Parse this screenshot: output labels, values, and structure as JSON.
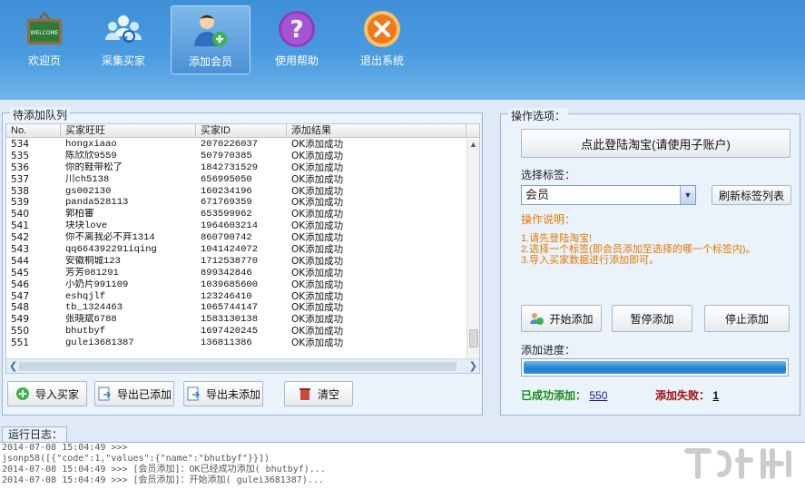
{
  "toolbar": {
    "items": [
      {
        "label": "欢迎页",
        "icon": "welcome-board-icon",
        "active": false
      },
      {
        "label": "采集买家",
        "icon": "collect-buyers-icon",
        "active": false
      },
      {
        "label": "添加会员",
        "icon": "add-member-icon",
        "active": true
      },
      {
        "label": "使用帮助",
        "icon": "help-icon",
        "active": false
      },
      {
        "label": "退出系统",
        "icon": "exit-icon",
        "active": false
      }
    ]
  },
  "queue": {
    "title": "待添加队列",
    "columns": [
      "No.",
      "买家旺旺",
      "买家ID",
      "添加结果"
    ],
    "rows": [
      [
        "534",
        "hongxiaao",
        "2070226037",
        "OK添加成功"
      ],
      [
        "535",
        "陈欣欣9559",
        "507970385",
        "OK添加成功"
      ],
      [
        "536",
        "你的鞋带松了",
        "1842731529",
        "OK添加成功"
      ],
      [
        "537",
        "川ch5138",
        "656995050",
        "OK添加成功"
      ],
      [
        "538",
        "gs002130",
        "160234196",
        "OK添加成功"
      ],
      [
        "539",
        "panda528113",
        "671769359",
        "OK添加成功"
      ],
      [
        "540",
        "郭柏審",
        "653599962",
        "OK添加成功"
      ],
      [
        "541",
        "块块love",
        "1964603214",
        "OK添加成功"
      ],
      [
        "542",
        "你不离我必不弃1314",
        "860790742",
        "OK添加成功"
      ],
      [
        "543",
        "qq664392291iqing",
        "1041424072",
        "OK添加成功"
      ],
      [
        "544",
        "安徽桐城123",
        "1712538770",
        "OK添加成功"
      ],
      [
        "545",
        "芳芳081291",
        "899342846",
        "OK添加成功"
      ],
      [
        "546",
        "小奶片991109",
        "1039685600",
        "OK添加成功"
      ],
      [
        "547",
        "eshqjlf",
        "123246410",
        "OK添加成功"
      ],
      [
        "548",
        "tb_1324463",
        "1065744147",
        "OK添加成功"
      ],
      [
        "549",
        "张晓斌6788",
        "1583130138",
        "OK添加成功"
      ],
      [
        "550",
        "bhutbyf",
        "1697420245",
        "OK添加成功"
      ],
      [
        "551",
        "gulei3681387",
        "136811386",
        "OK添加成功"
      ]
    ],
    "buttons": {
      "import": "导入买家",
      "export_added": "导出已添加",
      "export_unadded": "导出未添加",
      "clear": "清空"
    }
  },
  "options": {
    "title": "操作选项：",
    "login_button": "点此登陆淘宝(请使用子账户)",
    "select_tag_label": "选择标签：",
    "selected_tag": "会员",
    "refresh_tags": "刷新标签列表",
    "instructions_title": "操作说明：",
    "instructions": [
      "1.请先登陆淘宝!",
      "2.选择一个标签(即会员添加至选择的哪一个标签内)。",
      "3.导入买家数据进行添加即可。"
    ],
    "start": "开始添加",
    "pause": "暂停添加",
    "stop": "停止添加",
    "progress_label": "添加进度：",
    "progress": 1.0,
    "success_label": "已成功添加：",
    "success_count": "550",
    "fail_label": "添加失败：",
    "fail_count": "1"
  },
  "log": {
    "title": "运行日志：",
    "lines": [
      "2014-07-08 15:04:49 >>>",
      "jsonp58([{\"code\":1,\"values\":{\"name\":\"bhutbyf\"}}])",
      "2014-07-08 15:04:49 >>> [会员添加]：OK已经成功添加( bhutbyf)...",
      "2014-07-08 15:04:49 >>> [会员添加]：开始添加( gulei3681387)..."
    ]
  },
  "colors": {
    "toolbar": "#4a9be0",
    "instruction": "#e07a00",
    "success": "#1a8a1a",
    "fail": "#a01010",
    "progress": "#1e7fcf"
  }
}
